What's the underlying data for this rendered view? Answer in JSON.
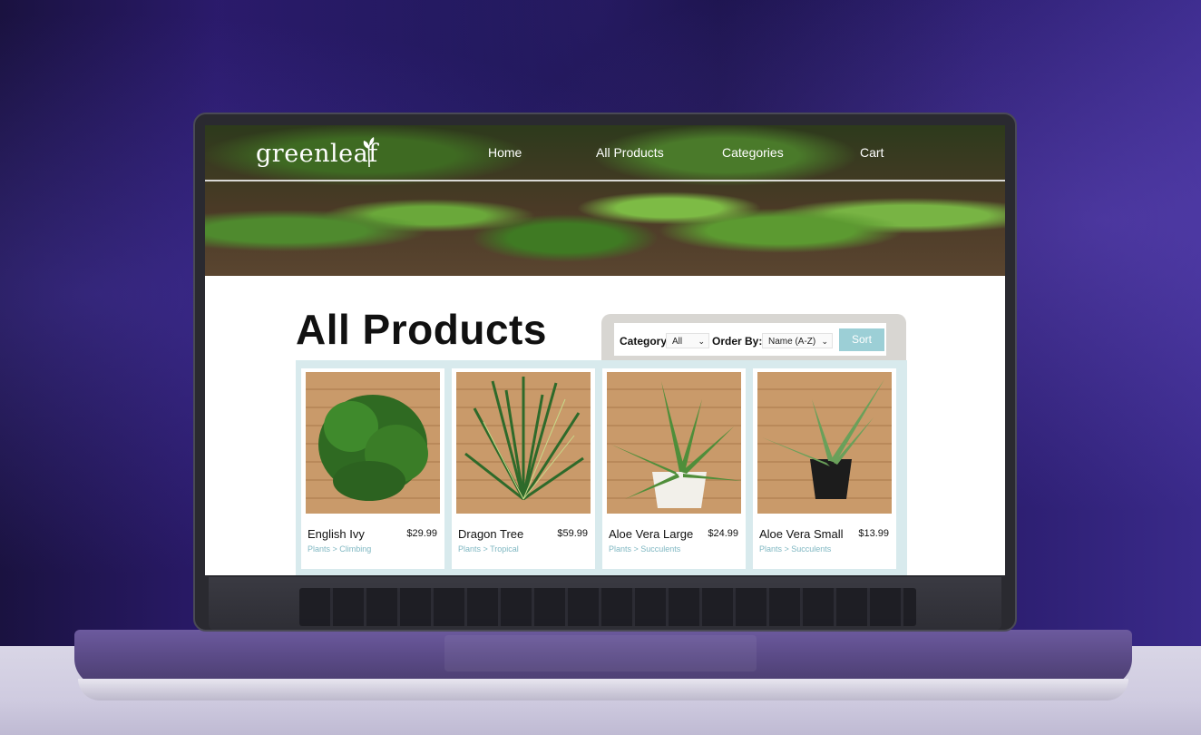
{
  "site": {
    "logo": "greenleaf",
    "nav": [
      "Home",
      "All Products",
      "Categories",
      "Cart"
    ]
  },
  "page": {
    "title": "All Products"
  },
  "filters": {
    "category_label": "Category:",
    "category_value": "All",
    "order_label": "Order By:",
    "order_value": "Name (A-Z)",
    "sort_label": "Sort"
  },
  "products": [
    {
      "name": "English Ivy",
      "price": "$29.99",
      "category": "Plants > Climbing"
    },
    {
      "name": "Dragon Tree",
      "price": "$59.99",
      "category": "Plants > Tropical"
    },
    {
      "name": "Aloe Vera Large",
      "price": "$24.99",
      "category": "Plants > Succulents"
    },
    {
      "name": "Aloe Vera Small",
      "price": "$13.99",
      "category": "Plants > Succulents"
    }
  ],
  "colors": {
    "accent": "#9ccfd6",
    "category_text": "#7fb7c2",
    "grid_bg": "#d8eaed"
  },
  "icons": [
    "sprout-icon",
    "chevron-down-icon"
  ]
}
